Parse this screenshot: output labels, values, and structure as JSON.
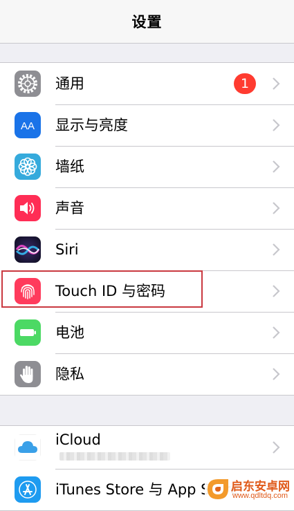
{
  "navbar": {
    "title": "设置"
  },
  "settings": {
    "general": {
      "label": "通用",
      "badge": "1"
    },
    "display": {
      "label": "显示与亮度",
      "icon_text": "AA"
    },
    "wallpaper": {
      "label": "墙纸"
    },
    "sounds": {
      "label": "声音"
    },
    "siri": {
      "label": "Siri"
    },
    "touchid": {
      "label": "Touch ID 与密码"
    },
    "battery": {
      "label": "电池"
    },
    "privacy": {
      "label": "隐私"
    }
  },
  "accounts": {
    "icloud": {
      "label": "iCloud"
    },
    "itunes": {
      "label": "iTunes Store 与 App Store"
    }
  },
  "watermark": {
    "title": "启东安卓网",
    "url": "www.qdltdq.com"
  },
  "colors": {
    "background": "#efeff4",
    "badge": "#ff3b30",
    "highlight_box": "#c9383f",
    "chevron": "#c7c7cc",
    "general_icon": "#8e8e93",
    "display_icon": "#1a73e8",
    "wallpaper_icon": "#35aadc",
    "sounds_icon": "#ff2d55",
    "touchid_icon": "#ff3b5c",
    "battery_icon": "#4cd964",
    "privacy_icon": "#8e8e93"
  },
  "icons": [
    "gear-icon",
    "display-brightness-icon",
    "wallpaper-flower-icon",
    "speaker-icon",
    "siri-icon",
    "fingerprint-icon",
    "battery-icon",
    "hand-icon",
    "icloud-icon",
    "app-store-icon",
    "chevron-right-icon"
  ]
}
